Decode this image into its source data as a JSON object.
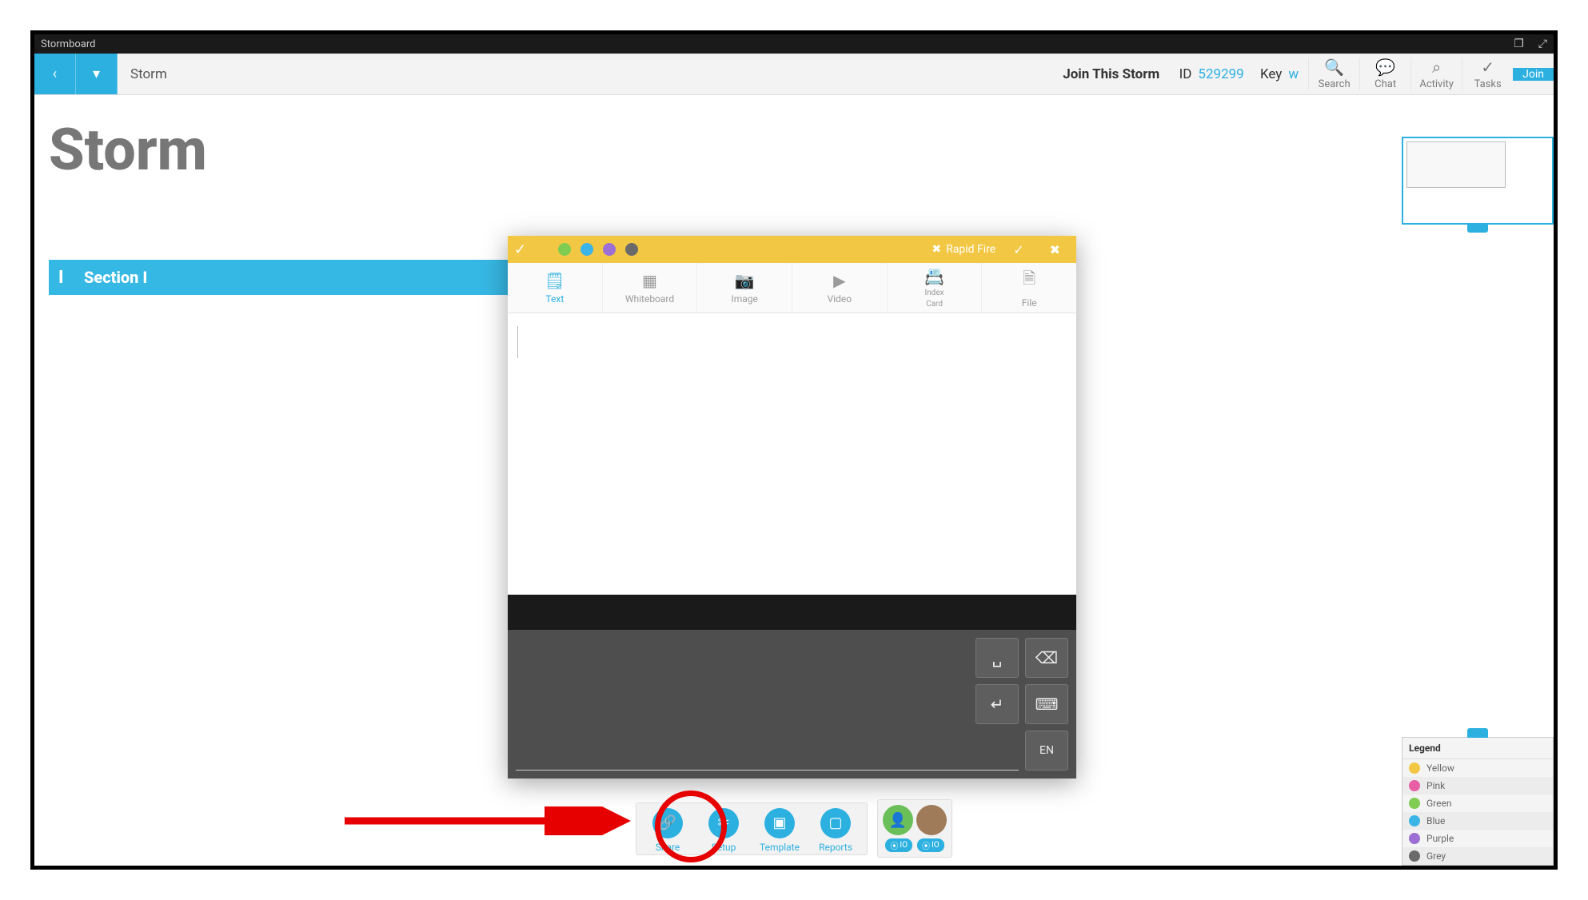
{
  "titlebar": {
    "appName": "Stormboard"
  },
  "topbar": {
    "breadcrumb": "Storm",
    "joinText": "Join This Storm",
    "idLabel": "ID",
    "idValue": "529299",
    "keyLabel": "Key",
    "keyValue": "w",
    "icons": {
      "search": "Search",
      "chat": "Chat",
      "activity": "Activity",
      "tasks": "Tasks"
    },
    "joinBtn": "Join"
  },
  "page": {
    "title": "Storm"
  },
  "section": {
    "number": "I",
    "label": "Section I"
  },
  "editor": {
    "rapidFire": "Rapid Fire",
    "tabs": {
      "text": "Text",
      "whiteboard": "Whiteboard",
      "image": "Image",
      "video": "Video",
      "indexCard1": "Index",
      "indexCard2": "Card",
      "file": "File"
    },
    "colors": {
      "pink": "#e85fa5",
      "green": "#7fcc52",
      "blue": "#3bb5e7",
      "purple": "#9b6fd3",
      "grey": "#6a6a6a"
    },
    "keyboard": {
      "lang": "EN"
    }
  },
  "dock": {
    "share": "Share",
    "setup": "Setup",
    "template": "Template",
    "reports": "Reports",
    "counter1": "IO",
    "counter2": "IO"
  },
  "legend": {
    "title": "Legend",
    "items": [
      {
        "label": "Yellow",
        "color": "#f2c743"
      },
      {
        "label": "Pink",
        "color": "#e85fa5"
      },
      {
        "label": "Green",
        "color": "#7fcc52"
      },
      {
        "label": "Blue",
        "color": "#3bb5e7"
      },
      {
        "label": "Purple",
        "color": "#9b6fd3"
      },
      {
        "label": "Grey",
        "color": "#6a6a6a"
      }
    ]
  }
}
